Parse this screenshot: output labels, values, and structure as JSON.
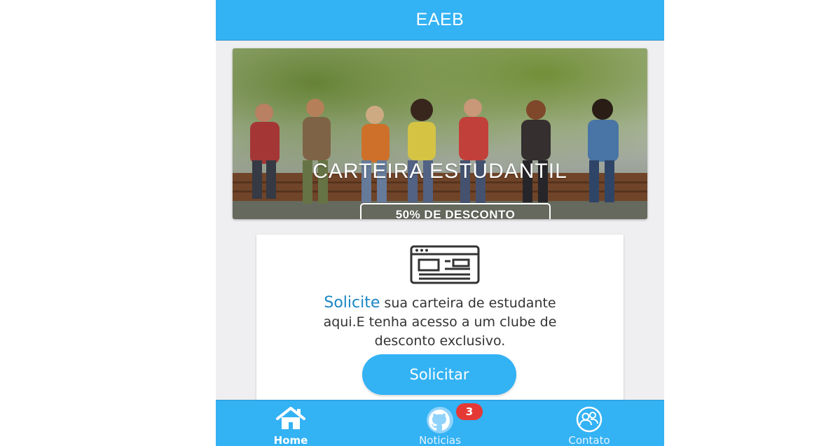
{
  "header": {
    "title": "EAEB"
  },
  "banner": {
    "title": "CARTEIRA ESTUDANTIL",
    "badge": "50% DE DESCONTO"
  },
  "card": {
    "icon": "document-icon",
    "highlight": "Solicite",
    "text_line1": " sua carteira de estudante",
    "text_line2": "aqui.E tenha acesso a um clube de",
    "text_line3": "desconto exclusivo.",
    "button_label": "Solicitar"
  },
  "tabs": [
    {
      "label": "Home",
      "icon": "home-icon",
      "active": true
    },
    {
      "label": "Noticias",
      "icon": "github-icon",
      "badge": "3"
    },
    {
      "label": "Contato",
      "icon": "contacts-icon"
    }
  ],
  "colors": {
    "primary": "#33b2f4",
    "highlight_text": "#1a86c5",
    "badge": "#e53935",
    "background": "#efeff1"
  }
}
